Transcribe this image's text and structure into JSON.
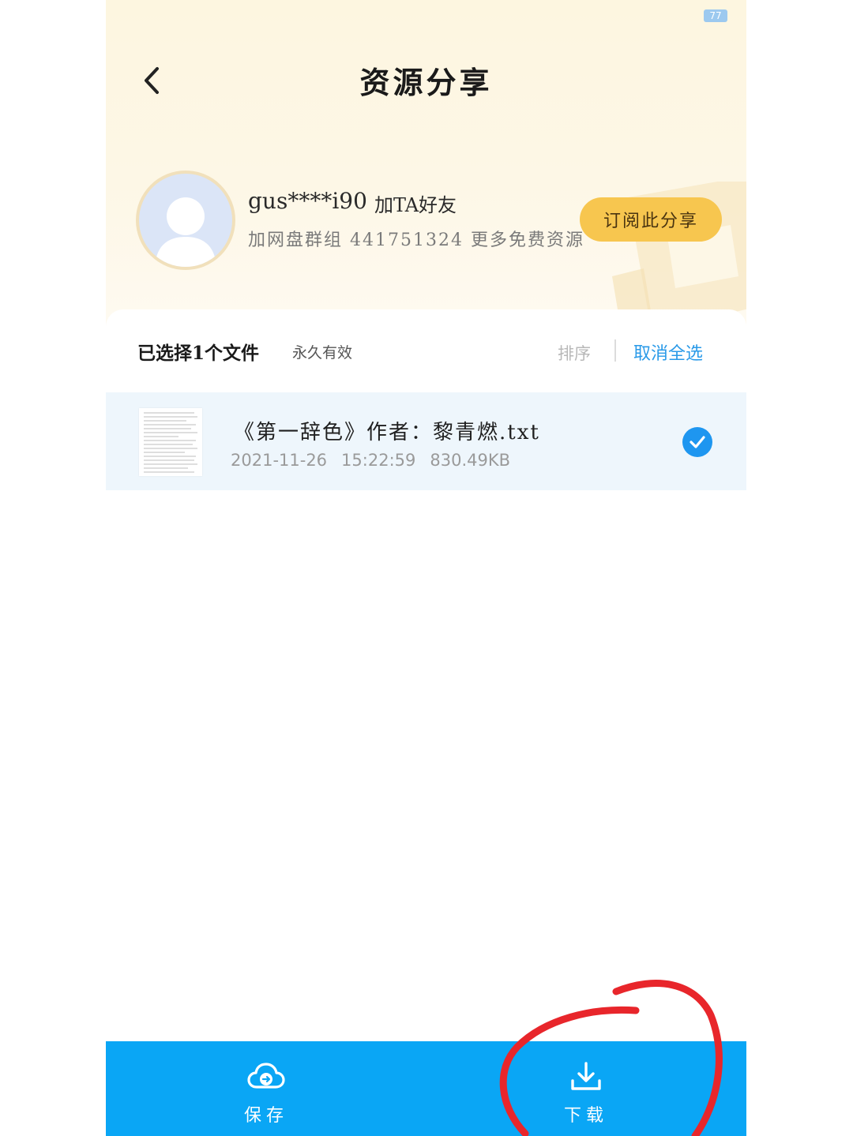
{
  "status_bar": {
    "battery": "77"
  },
  "header": {
    "title": "资源分享"
  },
  "sharer": {
    "username": "gus****i90",
    "add_friend_label": "加TA好友",
    "bio": "加网盘群组 441751324 更多免费资源",
    "subscribe_label": "订阅此分享"
  },
  "toolbar": {
    "selected_count": "已选择1个文件",
    "validity": "永久有效",
    "sort_label": "排序",
    "deselect_all_label": "取消全选"
  },
  "files": [
    {
      "name": "《第一辞色》作者：黎青燃.txt",
      "date": "2021-11-26",
      "time": "15:22:59",
      "size": "830.49KB",
      "selected": true
    }
  ],
  "bottom_bar": {
    "save_label": "保存",
    "download_label": "下载"
  },
  "colors": {
    "accent": "#0aa6f5",
    "link": "#2a9ae8",
    "subscribe": "#f7c64f",
    "annotation": "#e8262b"
  }
}
